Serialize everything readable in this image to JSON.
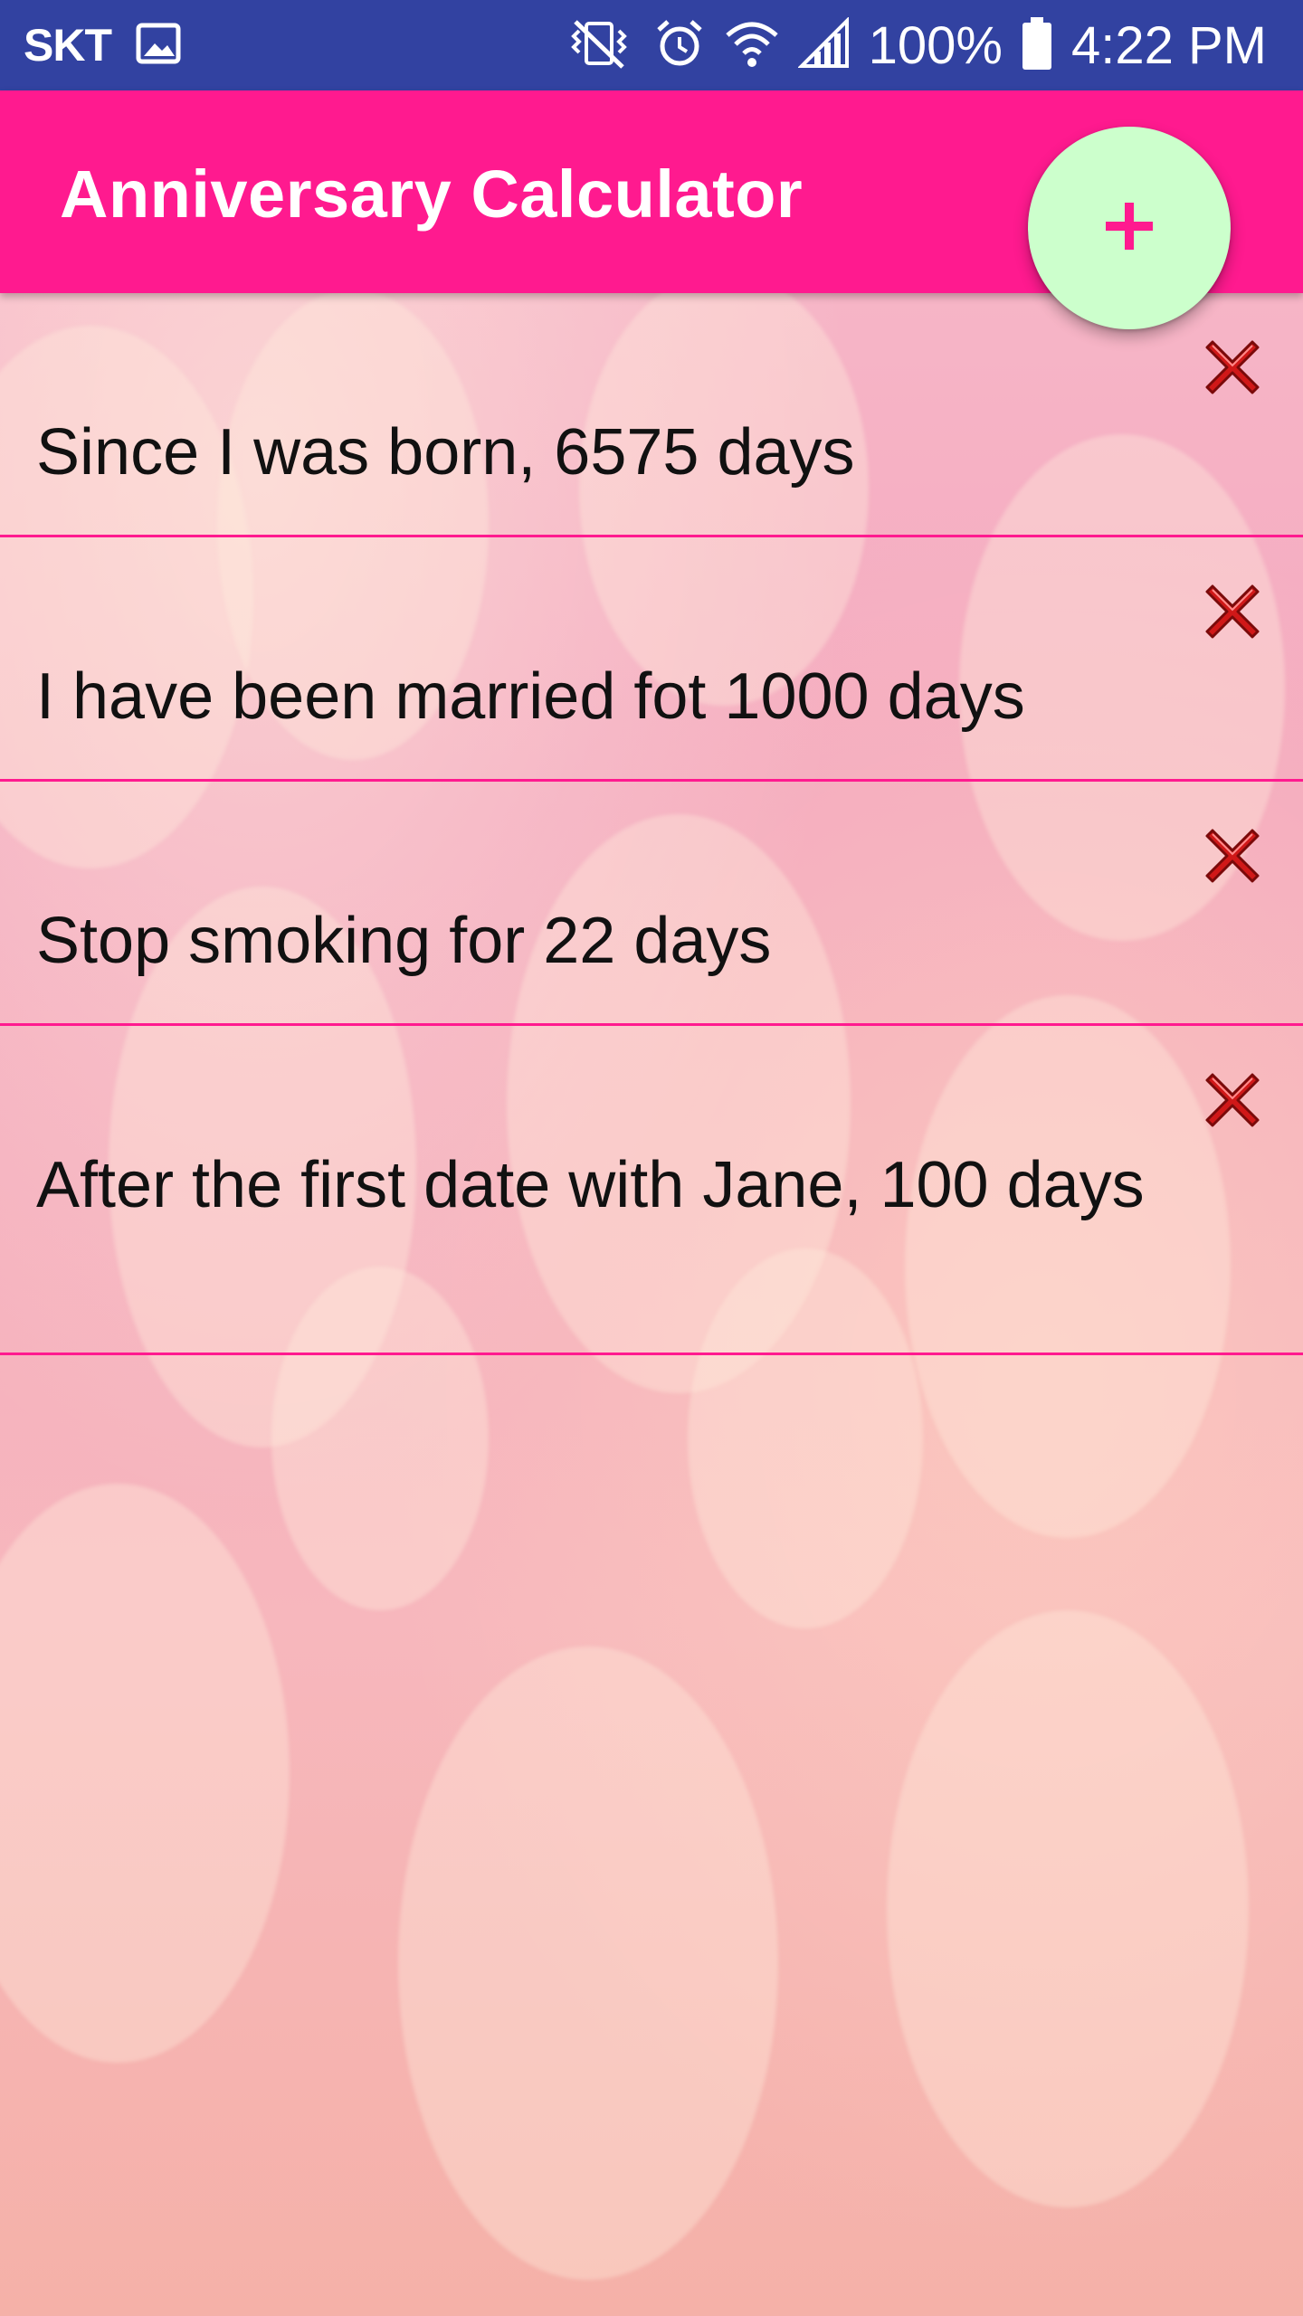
{
  "status_bar": {
    "carrier": "SKT",
    "battery": "100%",
    "time": "4:22 PM",
    "icons": [
      "gallery-icon",
      "vibrate-icon",
      "alarm-icon",
      "wifi-icon",
      "signal-icon",
      "battery-icon"
    ]
  },
  "app_bar": {
    "title": "Anniversary Calculator",
    "color": "#ff1a8f"
  },
  "fab": {
    "icon": "plus-icon",
    "color": "#ccffcc",
    "icon_color": "#ff1a8f"
  },
  "items": [
    {
      "text": "Since I was born, 6575 days"
    },
    {
      "text": "I have been married fot 1000 days"
    },
    {
      "text": "Stop smoking for 22 days"
    },
    {
      "text": "After the first date with Jane, 100 days"
    }
  ],
  "delete_icon": "close-x-icon"
}
